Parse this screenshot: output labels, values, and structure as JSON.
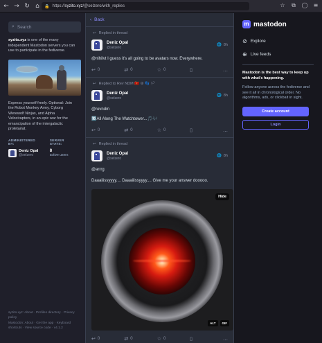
{
  "browser": {
    "url_host": "syzito.xyz",
    "url_path": "/@selzero/with_replies"
  },
  "left": {
    "search_placeholder": "Search",
    "about_server": "syzito.xyz",
    "about_text": " is one of the many independent Mastodon servers you can use to participate in the fediverse.",
    "express_text": "Express yourself freely. Optional: Join the Robot Monkey Army, Cyborg Werewolf Ninjas, and Alpha Velociraptors, in an epic war for the emancipation of the intergalactic proletariat.",
    "administered_by_label": "ADMINISTERED BY:",
    "server_stats_label": "SERVER STATS:",
    "admin_name": "Deniz Opal",
    "admin_handle": "@selzero",
    "active_users_count": "8",
    "active_users_label": "active users",
    "footer_text": "syzito.xyz: About · Profiles directory · Privacy policy",
    "footer_text2": "Mastodon: About · Get the app · Keyboard shortcuts · View source code · v4.1.2"
  },
  "center": {
    "back_label": "Back",
    "posts": [
      {
        "prepend": "Replied in thread",
        "name": "Deniz Opal",
        "handle": "@selzero",
        "time": "8h",
        "text": "@nihilvt I guess it's all going to be avatars now. Everywhere.",
        "replies": "0",
        "boosts": "0",
        "favs": "0"
      },
      {
        "prepend": "Replied to Rev NDM 🇲🇪 ☮ 👣 🏳",
        "name": "Deniz Opal",
        "handle": "@selzero",
        "time": "8h",
        "text1": "@revndm",
        "text2": "🔟All Along The Watchtower...🎵🎶",
        "replies": "0",
        "boosts": "0",
        "favs": "0"
      },
      {
        "prepend": "Replied in thread",
        "name": "Deniz Opal",
        "handle": "@selzero",
        "time": "8h",
        "text1": "@arrrg",
        "text2": "Daaaiiissyyyy.... Daaaiiissyyyy.... Give me your answer dooooo.",
        "hide_label": "Hide",
        "alt_label": "ALT",
        "gif_label": "GIF",
        "replies": "0",
        "boosts": "0",
        "favs": "0"
      }
    ]
  },
  "right": {
    "brand": "mastodon",
    "explore_label": "Explore",
    "live_feeds_label": "Live feeds",
    "pitch_bold": "Mastodon is the best way to keep up with what's happening.",
    "pitch_text": "Follow anyone across the fediverse and see it all in chronological order. No algorithms, ads, or clickbait in sight.",
    "create_account_label": "Create account",
    "login_label": "Login"
  }
}
